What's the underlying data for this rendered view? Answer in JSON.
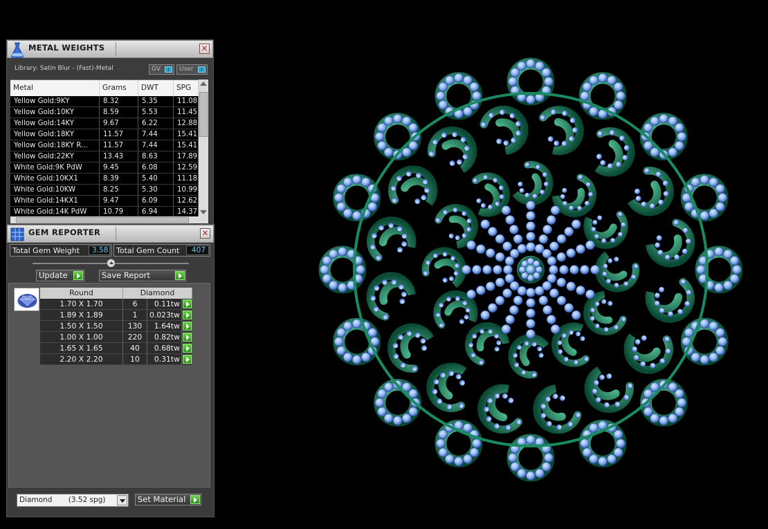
{
  "metal_weights": {
    "title": "METAL WEIGHTS",
    "library_label": "Library: Satin Blur - (Fast)-Metal",
    "toggle_gv": "GV",
    "toggle_user": "User",
    "toggle_knob": "I",
    "close_glyph": "✕",
    "columns": [
      "Metal",
      "Grams",
      "DWT",
      "SPG"
    ],
    "rows": [
      [
        "Yellow Gold:9KY",
        "8.32",
        "5.35",
        "11.08"
      ],
      [
        "Yellow Gold:10KY",
        "8.59",
        "5.53",
        "11.45"
      ],
      [
        "Yellow Gold:14KY",
        "9.67",
        "6.22",
        "12.88"
      ],
      [
        "Yellow Gold:18KY",
        "11.57",
        "7.44",
        "15.41"
      ],
      [
        "Yellow Gold:18KY R...",
        "11.57",
        "7.44",
        "15.41"
      ],
      [
        "Yellow Gold:22KY",
        "13.43",
        "8.63",
        "17.89"
      ],
      [
        "White Gold:9K PdW",
        "9.45",
        "6.08",
        "12.59"
      ],
      [
        "White Gold:10KX1",
        "8.39",
        "5.40",
        "11.18"
      ],
      [
        "White Gold:10KW",
        "8.25",
        "5.30",
        "10.99"
      ],
      [
        "White Gold:14KX1",
        "9.47",
        "6.09",
        "12.62"
      ],
      [
        "White Gold:14K PdW",
        "10.79",
        "6.94",
        "14.37"
      ]
    ]
  },
  "gem_reporter": {
    "title": "GEM REPORTER",
    "close_glyph": "✕",
    "total_weight_label": "Total Gem Weight",
    "total_weight_value": "3.58",
    "total_count_label": "Total Gem Count",
    "total_count_value": "407",
    "update_label": "Update",
    "save_report_label": "Save Report",
    "table_headers": [
      "Round",
      "Diamond"
    ],
    "rows": [
      [
        "1.70 X 1.70",
        "6",
        "0.11tw"
      ],
      [
        "1.89 X 1.89",
        "1",
        "0.023tw"
      ],
      [
        "1.50 X 1.50",
        "130",
        "1.64tw"
      ],
      [
        "1.00 X 1.00",
        "220",
        "0.82tw"
      ],
      [
        "1.65 X 1.65",
        "40",
        "0.68tw"
      ],
      [
        "2.20 X 2.20",
        "10",
        "0.31tw"
      ]
    ],
    "material_select": "Diamond       (3.52 spg)",
    "set_material_label": "Set Material"
  },
  "colors": {
    "metal_green": "#1a8a60",
    "gem_blue": "#8eb6f2",
    "accent_cyan": "#5fc8ee",
    "go_green": "#3fae2a"
  }
}
